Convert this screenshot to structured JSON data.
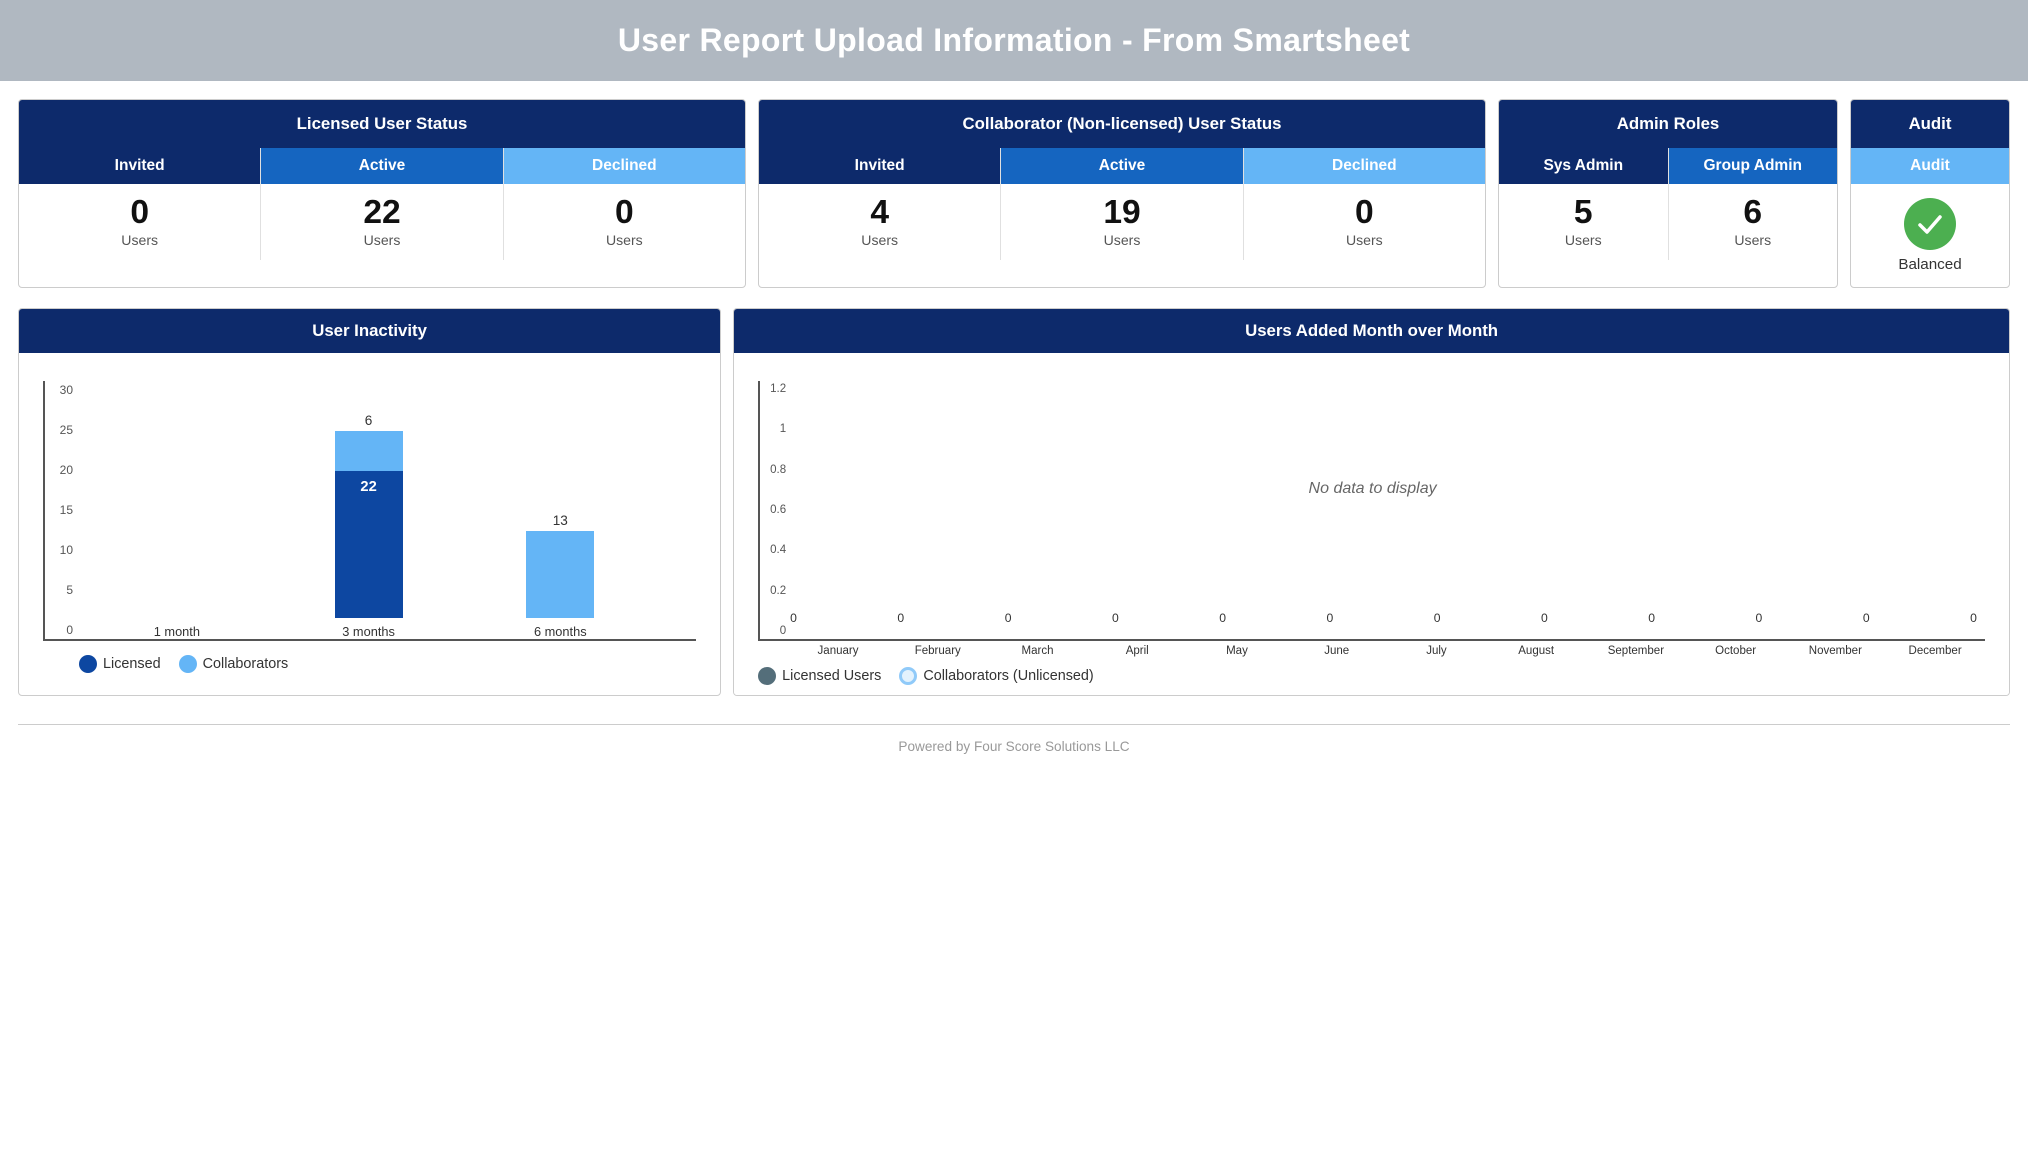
{
  "page": {
    "title": "User Report Upload Information - From Smartsheet"
  },
  "licensed_user_status": {
    "header": "Licensed User Status",
    "cols": [
      {
        "label": "Invited",
        "badge": "dark",
        "value": "0",
        "users": "Users"
      },
      {
        "label": "Active",
        "badge": "blue",
        "value": "22",
        "users": "Users"
      },
      {
        "label": "Declined",
        "badge": "light-blue",
        "value": "0",
        "users": "Users"
      }
    ]
  },
  "collaborator_user_status": {
    "header": "Collaborator (Non-licensed) User Status",
    "cols": [
      {
        "label": "Invited",
        "badge": "dark",
        "value": "4",
        "users": "Users"
      },
      {
        "label": "Active",
        "badge": "blue",
        "value": "19",
        "users": "Users"
      },
      {
        "label": "Declined",
        "badge": "light-blue",
        "value": "0",
        "users": "Users"
      }
    ]
  },
  "admin_roles": {
    "header": "Admin Roles",
    "cols": [
      {
        "label": "Sys Admin",
        "badge": "dark",
        "value": "5",
        "users": "Users"
      },
      {
        "label": "Group Admin",
        "badge": "blue",
        "value": "6",
        "users": "Users"
      }
    ]
  },
  "audit": {
    "header": "Audit",
    "badge": "Audit",
    "status": "Balanced"
  },
  "user_inactivity": {
    "header": "User Inactivity",
    "y_labels": [
      "0",
      "5",
      "10",
      "15",
      "20",
      "25",
      "30"
    ],
    "bars": [
      {
        "label": "1 month",
        "licensed_value": 0,
        "collaborator_value": 0,
        "top_label": "",
        "inner_label": ""
      },
      {
        "label": "3 months",
        "licensed_value": 22,
        "collaborator_value": 6,
        "top_label": "6",
        "inner_label": "22"
      },
      {
        "label": "6 months",
        "licensed_value": 0,
        "collaborator_value": 13,
        "top_label": "13",
        "inner_label": ""
      }
    ],
    "legend": [
      {
        "label": "Licensed",
        "color": "#0d47a1"
      },
      {
        "label": "Collaborators",
        "color": "#64b5f6"
      }
    ]
  },
  "users_added_mom": {
    "header": "Users Added Month over Month",
    "no_data": "No data to display",
    "y_labels": [
      "0",
      "0.2",
      "0.4",
      "0.6",
      "0.8",
      "1",
      "1.2"
    ],
    "months": [
      "January",
      "February",
      "March",
      "April",
      "May",
      "June",
      "July",
      "August",
      "September",
      "October",
      "November",
      "December"
    ],
    "month_values": [
      "0",
      "0",
      "0",
      "0",
      "0",
      "0",
      "0",
      "0",
      "0",
      "0",
      "0",
      "0"
    ],
    "legend": [
      {
        "label": "Licensed Users",
        "color": "#546e7a",
        "style": "filled"
      },
      {
        "label": "Collaborators (Unlicensed)",
        "color": "#b3e5fc",
        "style": "outlined"
      }
    ]
  },
  "footer": {
    "text": "Powered by Four Score Solutions LLC"
  }
}
